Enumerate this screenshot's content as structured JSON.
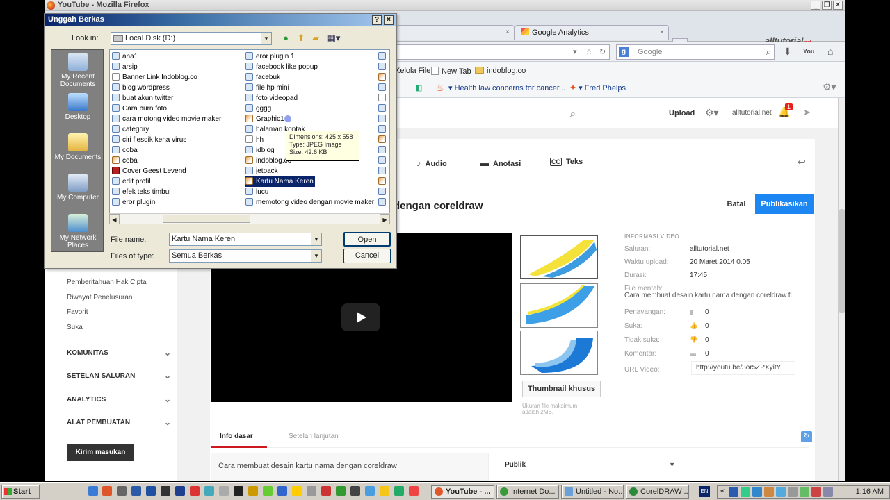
{
  "firefox": {
    "window_title": "YouTube - Mozilla Firefox",
    "tabs": [
      {
        "label": "",
        "close": "×"
      },
      {
        "label": "Google Analytics",
        "close": "×"
      }
    ],
    "new_tab": "+",
    "brand": "alltutorial",
    "brand_suffix": ".net",
    "search_placeholder": "Google",
    "bookmarks": [
      "Kelola File",
      "New Tab",
      "indoblog.co",
      "Health law concerns for cancer...",
      "Fred Phelps"
    ]
  },
  "youtube": {
    "upload": "Upload",
    "account": "alltutorial.net",
    "notification_count": "1",
    "sidebar": {
      "links": [
        "Pemberitahuan Hak Cipta",
        "Riwayat Penelusuran",
        "Favorit",
        "Suka"
      ],
      "sections": [
        "KOMUNITAS",
        "SETELAN SALURAN",
        "ANALYTICS",
        "ALAT PEMBUATAN"
      ],
      "feedback": "Kirim masukan"
    },
    "tools": [
      "Audio",
      "Anotasi",
      "Teks"
    ],
    "video_title_visible": "dengan coreldraw",
    "cancel": "Batal",
    "publish": "Publikasikan",
    "thumbnail_button": "Thumbnail khusus",
    "thumbnail_note": "Ukuran file maksimum adalah 2MB.",
    "info": {
      "heading": "INFORMASI VIDEO",
      "channel_k": "Saluran:",
      "channel_v": "alltutorial.net",
      "upload_k": "Waktu upload:",
      "upload_v": "20 Maret 2014 0.05",
      "duration_k": "Durasi:",
      "duration_v": "17:45",
      "raw_k": "File mentah:",
      "raw_v": "Cara membuat desain kartu nama dengan coreldraw.fl",
      "views_k": "Penayangan:",
      "views_v": "0",
      "likes_k": "Suka:",
      "likes_v": "0",
      "dislikes_k": "Tidak suka:",
      "dislikes_v": "0",
      "comments_k": "Komentar:",
      "comments_v": "0",
      "url_k": "URL Video:",
      "url_v": "http://youtu.be/3or5ZPXyitY"
    },
    "tab_basic": "Info dasar",
    "tab_advanced": "Setelan lanjutan",
    "description": "Cara membuat desain kartu nama dengan coreldraw",
    "privacy": "Publik"
  },
  "dialog": {
    "title": "Unggah Berkas",
    "help": "?",
    "close": "×",
    "look_in_label": "Look in:",
    "look_in_value": "Local Disk (D:)",
    "places": [
      "My Recent Documents",
      "Desktop",
      "My Documents",
      "My Computer",
      "My Network Places"
    ],
    "files_col1": [
      "ana1",
      "arsip",
      "Banner Link Indoblog.co",
      "blog wordpress",
      "buat akun twitter",
      "Cara burn foto",
      "cara motong video movie maker",
      "category",
      "ciri flesdik kena virus",
      "coba",
      "coba",
      "Cover Geest Levend",
      "edit profil",
      "efek teks timbul",
      "eror plugin"
    ],
    "files_col2": [
      "eror plugin 1",
      "facebook like popup",
      "facebuk",
      "file hp mini",
      "foto videopad",
      "gggg",
      "Graphic1",
      "halaman kontak",
      "hh",
      "idblog",
      "indoblog.co",
      "jetpack",
      "Kartu Nama Keren",
      "lucu",
      "memotong video dengan movie maker"
    ],
    "tooltip": [
      "Dimensions: 425 x 558",
      "Type: JPEG Image",
      "Size: 42.6 KB"
    ],
    "file_name_label": "File name:",
    "file_name_value": "Kartu Nama Keren",
    "file_type_label": "Files of type:",
    "file_type_value": "Semua Berkas",
    "open": "Open",
    "cancel": "Cancel"
  },
  "taskbar": {
    "start": "Start",
    "tasks": [
      "YouTube - ...",
      "Internet Do...",
      "Untitled - No...",
      "CorelDRAW ..."
    ],
    "lang": "EN",
    "clock": "1:16 AM"
  }
}
